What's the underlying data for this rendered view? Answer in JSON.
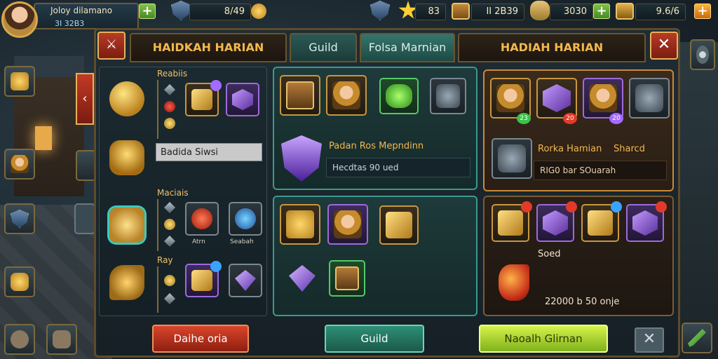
{
  "player": {
    "name": "Joloy dilamano",
    "id": "3I 32B3"
  },
  "resources": {
    "shield": "8/49",
    "star": "83",
    "chest": "II 2B39",
    "scroll": "3030",
    "gold": "9.6/6"
  },
  "tabs": [
    {
      "label": "HAIDKAH HARIAN"
    },
    {
      "label": "Guild"
    },
    {
      "label": "Folsa Marnian"
    },
    {
      "label": "HADIAH HARIAN"
    }
  ],
  "left": {
    "section1": "Reabiis",
    "field": "Badida Siwsi",
    "section2": "Maciais",
    "section3": "Ray",
    "slot_caption1": "Atrn",
    "slot_caption2": "Seabah"
  },
  "middle": {
    "offer_title": "Padan Ros Mepndinn",
    "offer_desc": "Hecdtas 90 ued"
  },
  "right": {
    "offer_title": "Rorka Hamian",
    "offer_tag": "Sharcd",
    "offer_desc": "RIG0 bar SOuarah",
    "label_small": "Soed",
    "reward_text": "22000 b 50 onje",
    "badge_count": "23",
    "badge_count2": "20",
    "badge_count3": "20"
  },
  "buttons": {
    "left": "Daihe oria",
    "center": "Guild",
    "right": "Naoalh Glirnan"
  },
  "accent_colors": {
    "gold": "#f3b84e",
    "teal": "#3a9a8e",
    "red": "#d9452b",
    "lime": "#d6f24a"
  },
  "icons": [
    "shield-icon",
    "star-icon",
    "chest-icon",
    "scroll-icon",
    "gold-chest-icon",
    "plus-icon",
    "close-icon",
    "sword-icon",
    "gear-icon"
  ]
}
